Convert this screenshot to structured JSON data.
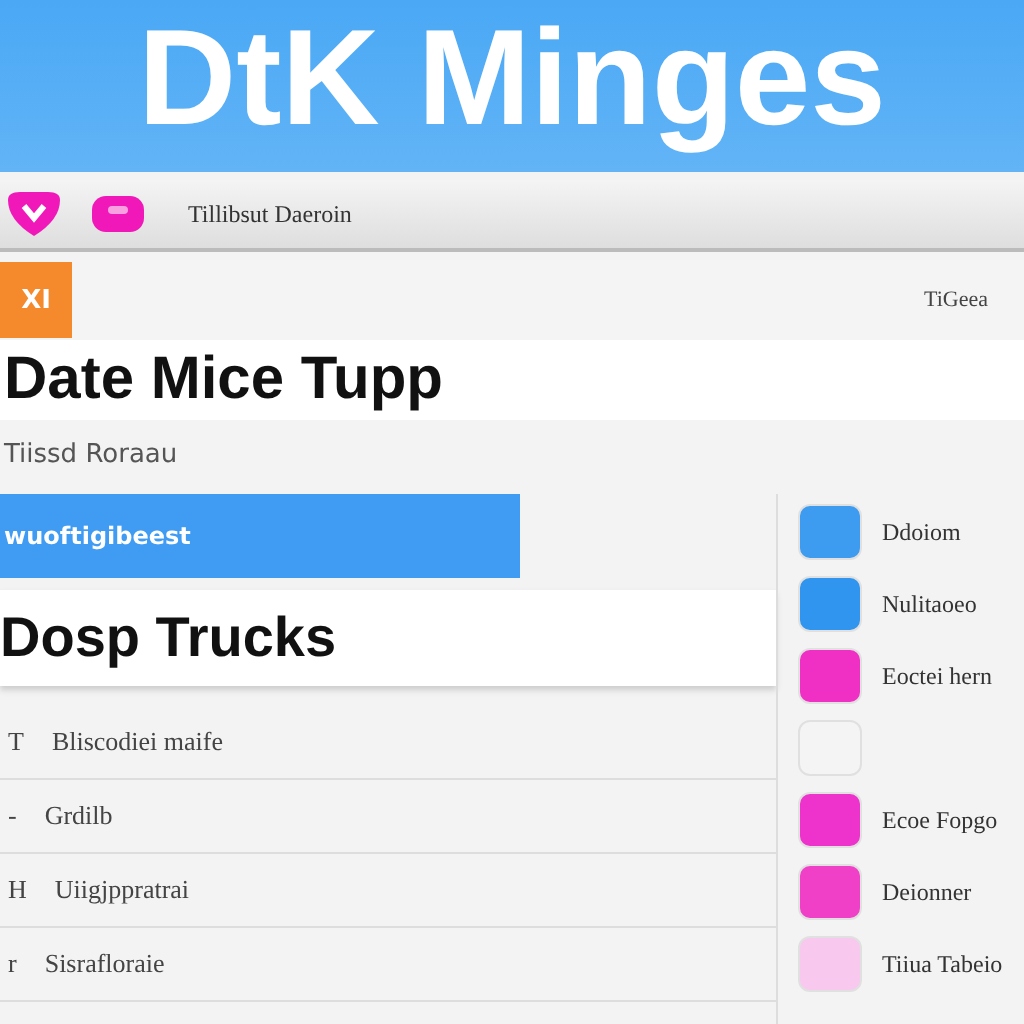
{
  "header": {
    "title": "DtK Minges"
  },
  "toolbar": {
    "label": "Tillibsut Daeroin"
  },
  "tag_row": {
    "tag": "XI",
    "right_label": "TiGeea"
  },
  "heading": {
    "title": "Date Mice Tupp",
    "subtitle": "Tiissd Roraau"
  },
  "list": {
    "selected_item": {
      "label": "wuoftigibeest",
      "selected": true
    },
    "section_title": "Dosp Trucks",
    "rows": [
      {
        "marker": "T",
        "label": "Bliscodiei maife"
      },
      {
        "marker": "-",
        "label": "Grdilb"
      },
      {
        "marker": "H",
        "label": "Uiigjppratrai"
      },
      {
        "marker": "r",
        "label": "Sisrafloraie"
      }
    ]
  },
  "side_items": [
    {
      "color": "#3d9bf0",
      "label": "Ddoiom"
    },
    {
      "color": "#2f95ee",
      "label": "Nulitaoeo"
    },
    {
      "color": "#f02fc4",
      "label": "Eoctei hern"
    },
    {
      "color": "#f4f4f4"
    },
    {
      "color": "#ee33cc",
      "label": "Ecoe Fopgo"
    },
    {
      "color": "#f040c8",
      "label": "Deionner"
    },
    {
      "color": "#f8c8ee",
      "label": "Tiiua Tabeio"
    }
  ]
}
